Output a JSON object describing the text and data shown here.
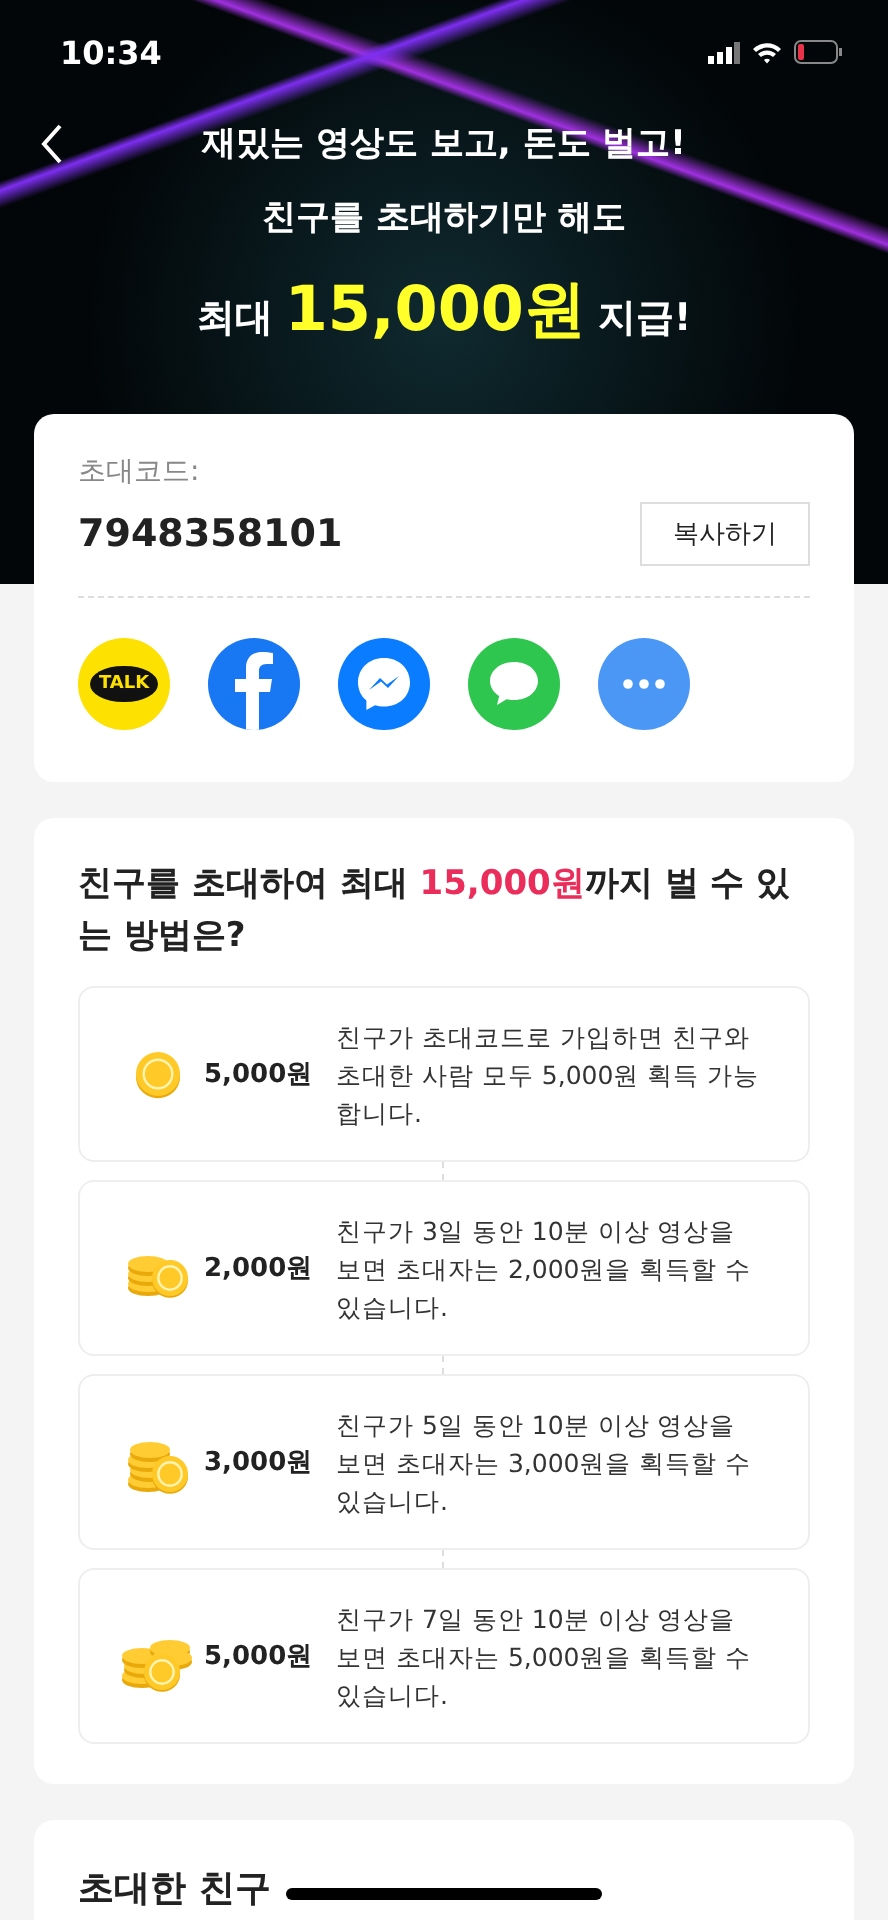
{
  "status_bar": {
    "time": "10:34"
  },
  "banner": {
    "line_1": "재밌는 영상도 보고, 돈도 벌고!",
    "line_2": "친구를 초대하기만 해도",
    "line_3_before": "최대",
    "line_3_amount": "15,000원",
    "line_3_after": "지급!"
  },
  "invite_code": {
    "label": "초대코드:",
    "code": "7948358101",
    "copy_button": "복사하기"
  },
  "share_targets": [
    {
      "kind": "talk",
      "label": "TALK"
    },
    {
      "kind": "facebook"
    },
    {
      "kind": "messenger"
    },
    {
      "kind": "message"
    },
    {
      "kind": "more"
    }
  ],
  "rewards": {
    "heading_before": "친구를 초대하여 최대 ",
    "heading_highlight": "15,000원",
    "heading_after": "까지 벌 수 있는 방법은?",
    "items": [
      {
        "kind": "single",
        "amount": "5,000원",
        "description": "친구가 초대코드로 가입하면 친구와 초대한 사람 모두 5,000원 획득 가능합니다."
      },
      {
        "kind": "small",
        "amount": "2,000원",
        "description": "친구가 3일 동안 10분 이상 영상을 보면 초대자는 2,000원을 획득할 수 있습니다."
      },
      {
        "kind": "medium",
        "amount": "3,000원",
        "description": "친구가 5일 동안 10분 이상 영상을 보면 초대자는 3,000원을 획득할 수 있습니다."
      },
      {
        "kind": "large",
        "amount": "5,000원",
        "description": "친구가 7일 동안 10분 이상 영상을 보면 초대자는 5,000원을 획득할 수 있습니다."
      }
    ]
  },
  "invited_friends": {
    "title": "초대한 친구"
  }
}
